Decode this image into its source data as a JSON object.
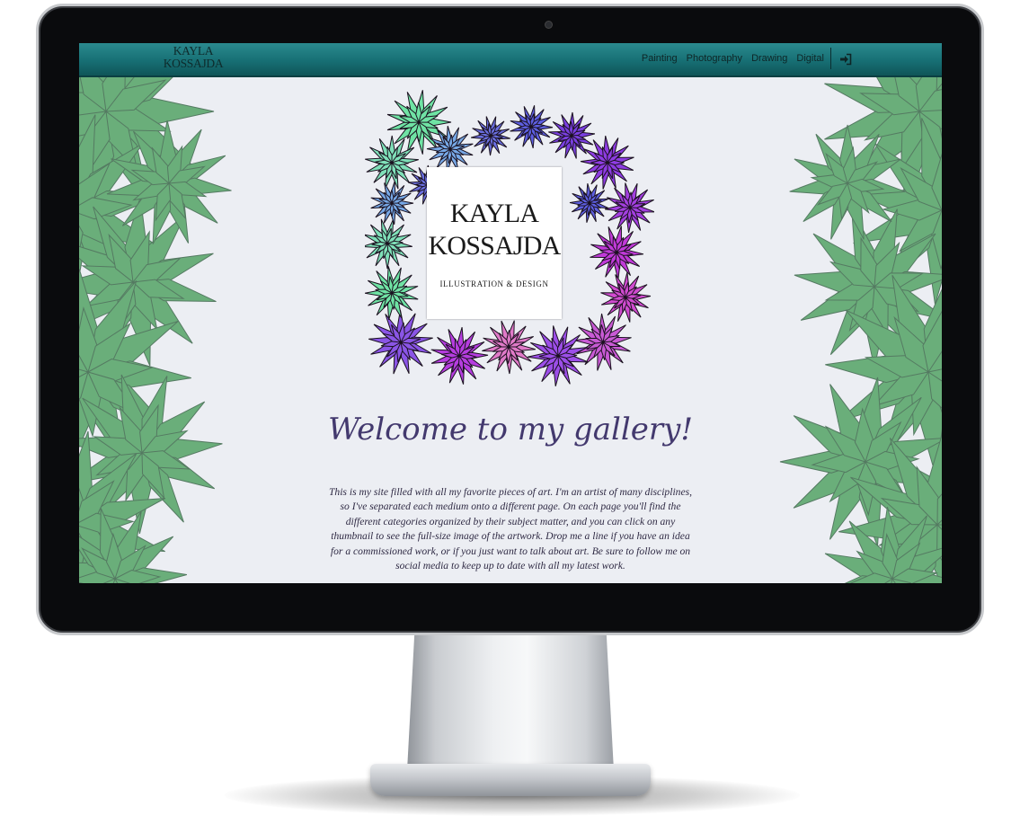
{
  "nav": {
    "brand_line1": "KAYLA",
    "brand_line2": "KOSSAJDA",
    "links": [
      "Painting",
      "Photography",
      "Drawing",
      "Digital"
    ],
    "login_icon": "sign-in-icon"
  },
  "hero": {
    "logo_line1": "KAYLA",
    "logo_line2": "KOSSAJDA",
    "logo_subtitle": "ILLUSTRATION & DESIGN"
  },
  "welcome": {
    "heading": "Welcome to my gallery!",
    "intro": "This is my site filled with all my favorite pieces of art. I'm an artist of many disciplines, so I've separated each medium onto a different page. On each page you'll find the different categories organized by their subject matter, and you can click on any thumbnail to see the full-size image of the artwork. Drop me a line if you have an idea for a commissioned work, or if you just want to talk about art. Be sure to follow me on social media to keep up to date with all my latest work."
  },
  "colors": {
    "navbar": "#176f74",
    "page_background": "#eceef3",
    "leaf_green": "#6aae7a",
    "leaf_outline": "#557a62",
    "heading": "#43396e"
  }
}
